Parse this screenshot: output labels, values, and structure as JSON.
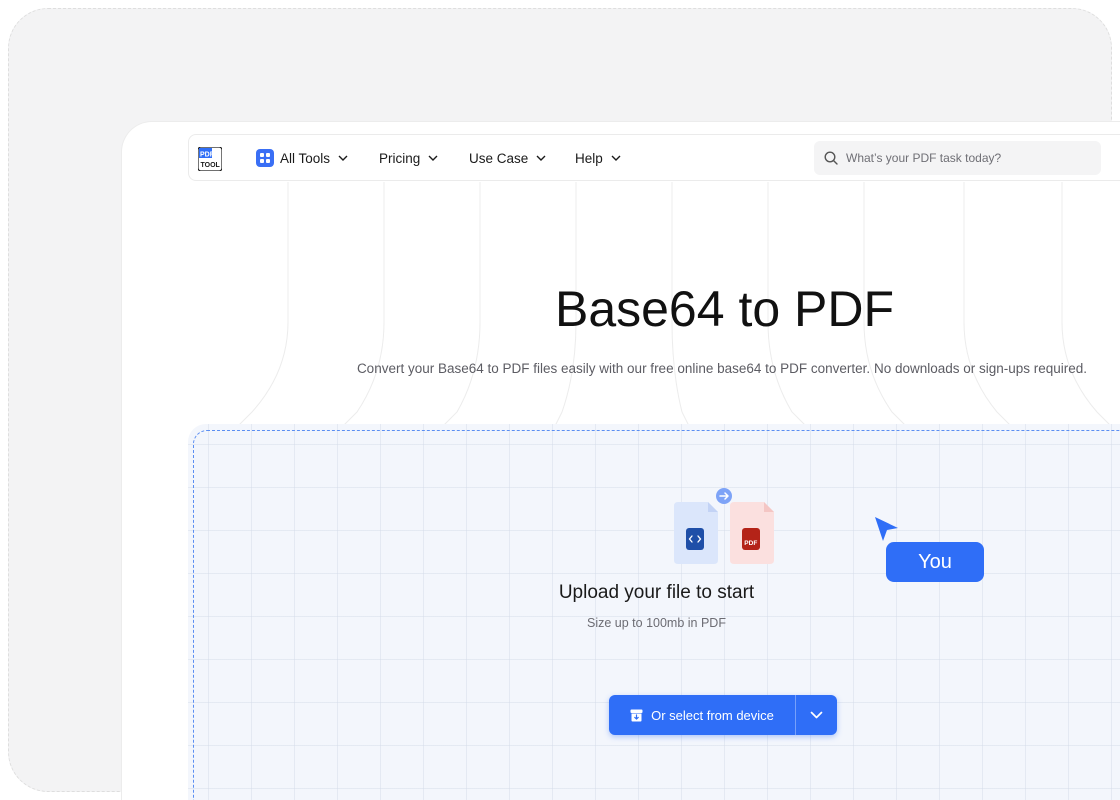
{
  "nav": {
    "logo_text": "PDF TOOL",
    "items": [
      {
        "label": "All Tools"
      },
      {
        "label": "Pricing"
      },
      {
        "label": "Use Case"
      },
      {
        "label": "Help"
      }
    ],
    "search": {
      "placeholder": "What’s your PDF task today?",
      "value": ""
    }
  },
  "hero": {
    "title": "Base64 to PDF",
    "subtitle": "Convert your Base64 to PDF files easily with our free online base64 to PDF converter. No downloads or sign-ups required."
  },
  "upload": {
    "title": "Upload your file to start",
    "note": "Size up to 100mb in PDF",
    "button_label": "Or select from device",
    "source_icon": "code-file-icon",
    "target_icon": "pdf-file-icon",
    "target_icon_label": "PDF"
  },
  "cursor": {
    "label": "You"
  },
  "colors": {
    "accent": "#2f6ef7",
    "pdf_red": "#b42318",
    "code_blue": "#1f4fa8"
  }
}
